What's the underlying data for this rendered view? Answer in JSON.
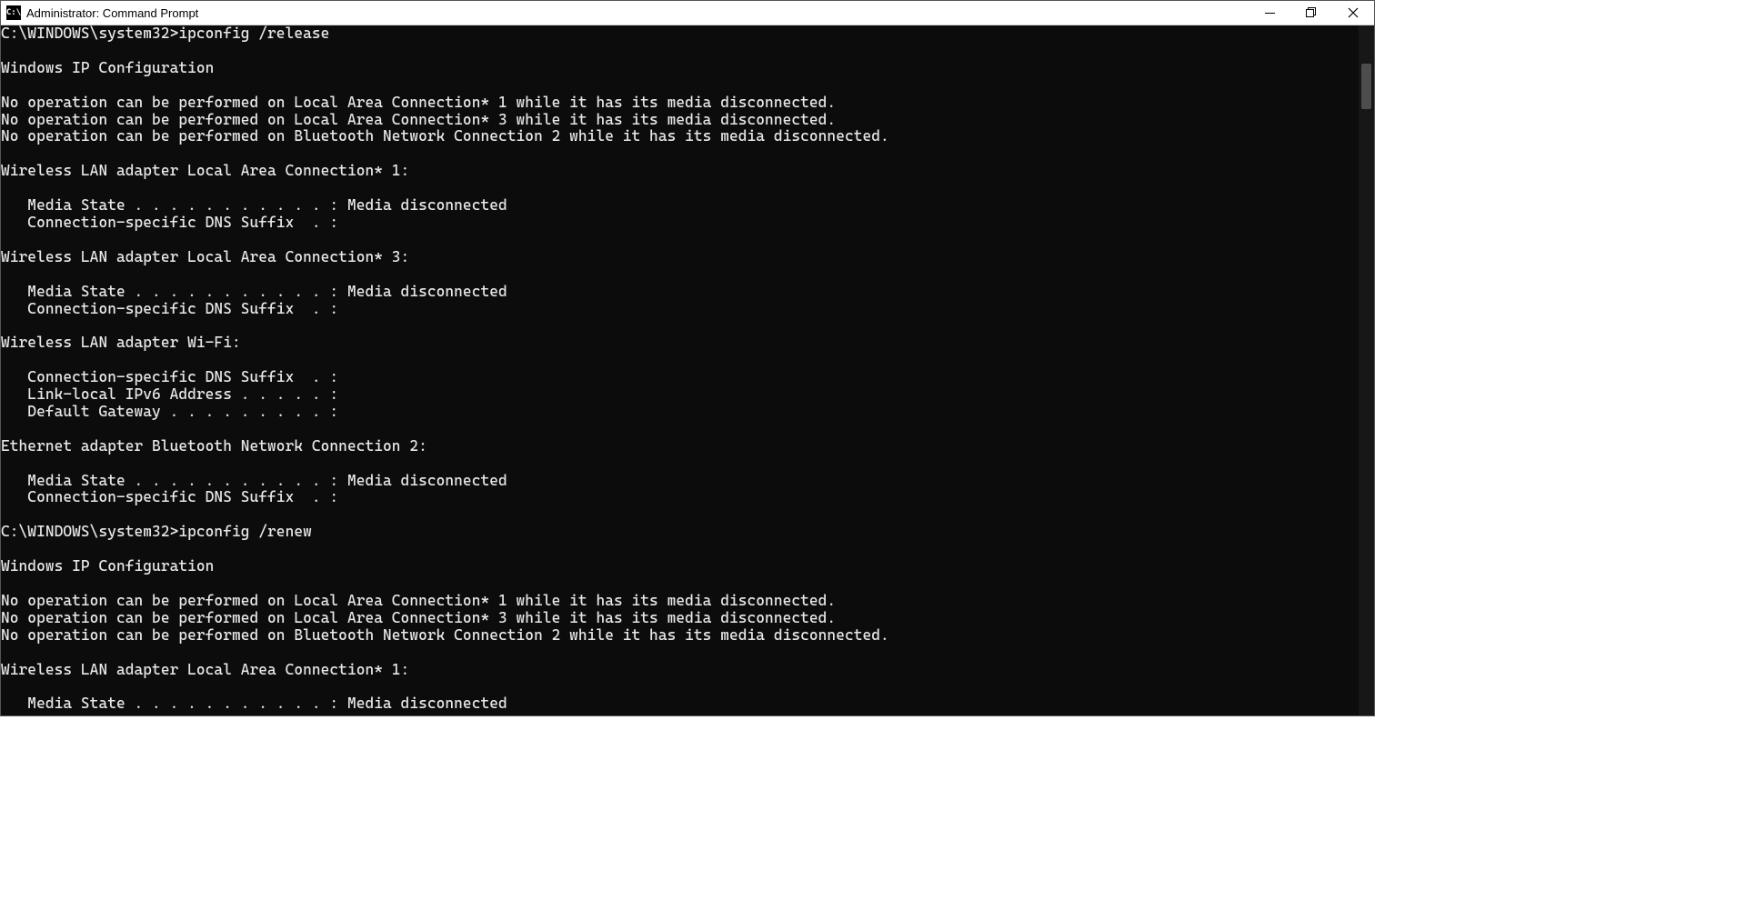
{
  "titlebar": {
    "icon_label": "C:\\",
    "title": "Administrator: Command Prompt"
  },
  "controls": {
    "minimize_glyph": "─",
    "maximize_glyph": "❐",
    "close_glyph": "✕"
  },
  "terminal": {
    "lines": [
      "C:\\WINDOWS\\system32>ipconfig /release",
      "",
      "Windows IP Configuration",
      "",
      "No operation can be performed on Local Area Connection* 1 while it has its media disconnected.",
      "No operation can be performed on Local Area Connection* 3 while it has its media disconnected.",
      "No operation can be performed on Bluetooth Network Connection 2 while it has its media disconnected.",
      "",
      "Wireless LAN adapter Local Area Connection* 1:",
      "",
      "   Media State . . . . . . . . . . . : Media disconnected",
      "   Connection-specific DNS Suffix  . :",
      "",
      "Wireless LAN adapter Local Area Connection* 3:",
      "",
      "   Media State . . . . . . . . . . . : Media disconnected",
      "   Connection-specific DNS Suffix  . :",
      "",
      "Wireless LAN adapter Wi-Fi:",
      "",
      "   Connection-specific DNS Suffix  . :",
      "   Link-local IPv6 Address . . . . . :",
      "   Default Gateway . . . . . . . . . :",
      "",
      "Ethernet adapter Bluetooth Network Connection 2:",
      "",
      "   Media State . . . . . . . . . . . : Media disconnected",
      "   Connection-specific DNS Suffix  . :",
      "",
      "C:\\WINDOWS\\system32>ipconfig /renew",
      "",
      "Windows IP Configuration",
      "",
      "No operation can be performed on Local Area Connection* 1 while it has its media disconnected.",
      "No operation can be performed on Local Area Connection* 3 while it has its media disconnected.",
      "No operation can be performed on Bluetooth Network Connection 2 while it has its media disconnected.",
      "",
      "Wireless LAN adapter Local Area Connection* 1:",
      "",
      "   Media State . . . . . . . . . . . : Media disconnected"
    ]
  }
}
